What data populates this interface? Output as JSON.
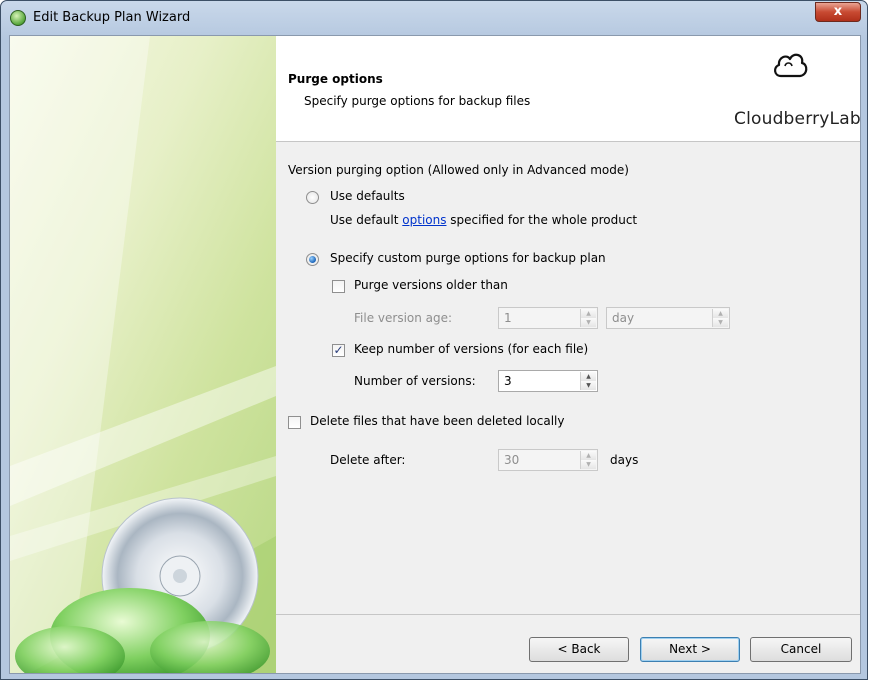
{
  "window": {
    "title": "Edit Backup Plan Wizard",
    "close_glyph": "x"
  },
  "header": {
    "title": "Purge options",
    "subtitle": "Specify purge options for backup files",
    "brand": "CloudberryLab",
    "logo_icon": "cloud-icon"
  },
  "content": {
    "section_label": "Version purging option (Allowed only in Advanced mode)",
    "use_defaults": {
      "label": "Use defaults",
      "selected": false,
      "desc_prefix": "Use default ",
      "desc_link": "options",
      "desc_suffix": " specified for the whole product"
    },
    "custom": {
      "label": "Specify custom purge options for backup plan",
      "selected": true,
      "purge_older": {
        "label": "Purge versions older than",
        "checked": false
      },
      "file_age": {
        "label": "File version age:",
        "value": "1",
        "unit": "day"
      },
      "keep_number": {
        "label": "Keep number of versions (for each file)",
        "checked": true
      },
      "num_versions": {
        "label": "Number of versions:",
        "value": "3"
      }
    },
    "delete_local": {
      "label": "Delete files that have been deleted locally",
      "checked": false,
      "delete_after_label": "Delete after:",
      "value": "30",
      "unit": "days"
    }
  },
  "buttons": {
    "back": "< Back",
    "next": "Next >",
    "cancel": "Cancel"
  }
}
